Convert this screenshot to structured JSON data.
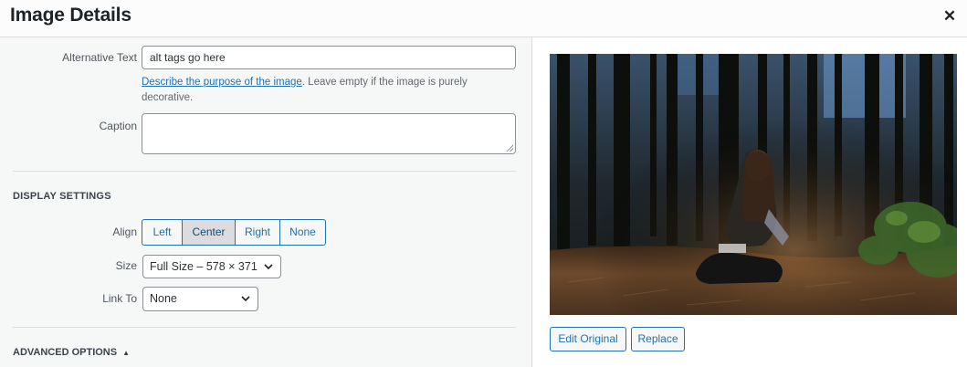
{
  "header": {
    "title": "Image Details",
    "close_icon": "close-icon"
  },
  "form": {
    "alt_label": "Alternative Text",
    "alt_value": "alt tags go here",
    "help_link": "Describe the purpose of the image",
    "help_text": ". Leave empty if the image is purely decorative.",
    "caption_label": "Caption",
    "caption_value": ""
  },
  "display": {
    "section_title": "Display Settings",
    "align_label": "Align",
    "align_options": [
      "Left",
      "Center",
      "Right",
      "None"
    ],
    "align_selected": "Center",
    "size_label": "Size",
    "size_value": "Full Size – 578 × 371",
    "link_label": "Link To",
    "link_value": "None"
  },
  "advanced": {
    "label": "Advanced Options",
    "icon": "triangle-up-icon"
  },
  "preview": {
    "edit_button": "Edit Original",
    "replace_button": "Replace"
  },
  "colors": {
    "accent": "#2271b1",
    "panel_bg": "#f6f7f7",
    "border": "#8c8f94"
  }
}
